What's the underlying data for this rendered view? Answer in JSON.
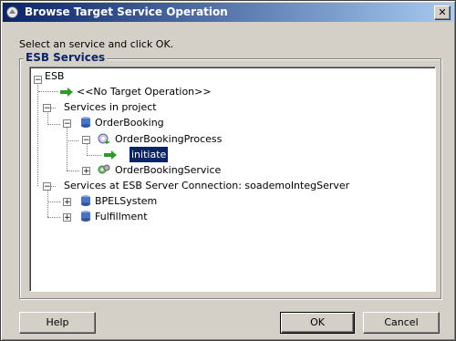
{
  "window": {
    "title": "Browse Target Service Operation",
    "close_glyph": "✕"
  },
  "instruction": "Select an service and click OK.",
  "group_label": "ESB Services",
  "tree": {
    "root": "ESB",
    "no_target": "<<No Target Operation>>",
    "services_in_project": "Services in project",
    "order_booking": "OrderBooking",
    "order_booking_process": "OrderBookingProcess",
    "initiate": "initiate",
    "order_booking_service": "OrderBookingService",
    "server_connection": "Services at ESB Server Connection: soademoIntegServer",
    "bpel_system": "BPELSystem",
    "fulfillment": "Fulfillment",
    "expanded_glyph": "−",
    "collapsed_glyph": "+"
  },
  "buttons": {
    "help": "Help",
    "ok": "OK",
    "cancel": "Cancel"
  },
  "colors": {
    "title_start": "#0a246a",
    "title_end": "#a6caf0",
    "selection": "#0a246a",
    "arrow_green": "#2e9a2e",
    "db_blue": "#4a74c9"
  },
  "icons": {
    "title": "dialog-icon",
    "operation": "green-arrow-icon",
    "service": "database-icon",
    "process": "process-gear-icon",
    "adapter": "adapter-gear-icon"
  }
}
